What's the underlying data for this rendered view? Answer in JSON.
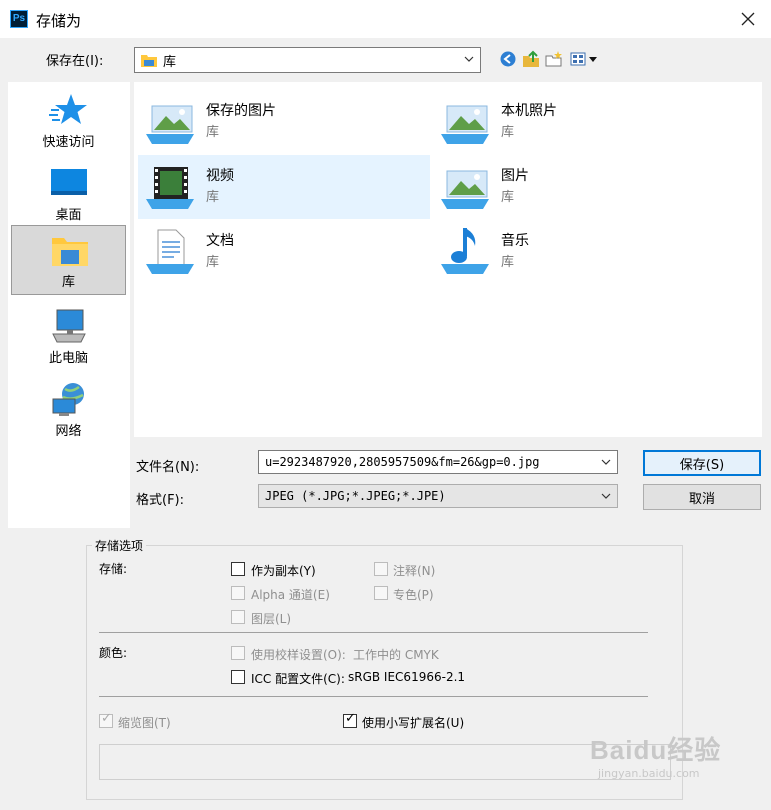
{
  "window": {
    "title": "存储为",
    "app_icon": "Ps"
  },
  "location": {
    "label": "保存在(I):",
    "value": "库"
  },
  "sidebar": {
    "items": [
      {
        "label": "快速访问",
        "icon": "star-icon"
      },
      {
        "label": "桌面",
        "icon": "desktop-icon"
      },
      {
        "label": "库",
        "icon": "library-folder-icon",
        "selected": true
      },
      {
        "label": "此电脑",
        "icon": "computer-icon"
      },
      {
        "label": "网络",
        "icon": "network-icon"
      }
    ]
  },
  "files": [
    {
      "name": "保存的图片",
      "type": "库"
    },
    {
      "name": "本机照片",
      "type": "库"
    },
    {
      "name": "视频",
      "type": "库",
      "highlighted": true
    },
    {
      "name": "图片",
      "type": "库"
    },
    {
      "name": "文档",
      "type": "库"
    },
    {
      "name": "音乐",
      "type": "库"
    }
  ],
  "filename": {
    "label": "文件名(N):",
    "value": "u=2923487920,2805957509&fm=26&gp=0.jpg"
  },
  "format": {
    "label": "格式(F):",
    "value": "JPEG (*.JPG;*.JPEG;*.JPE)"
  },
  "buttons": {
    "save": "保存(S)",
    "cancel": "取消"
  },
  "options": {
    "title": "存储选项",
    "storage_label": "存储:",
    "as_copy": "作为副本(Y)",
    "notes": "注释(N)",
    "alpha": "Alpha 通道(E)",
    "spot": "专色(P)",
    "layers": "图层(L)",
    "color_label": "颜色:",
    "proof": "使用校样设置(O):",
    "proof_value": "工作中的 CMYK",
    "icc": "ICC 配置文件(C):",
    "icc_value": "sRGB IEC61966-2.1",
    "thumbnail": "缩览图(T)",
    "lowercase": "使用小写扩展名(U)"
  },
  "watermark": {
    "brand": "Baidu经验",
    "url": "jingyan.baidu.com"
  },
  "colors": {
    "accent": "#0078d7",
    "highlight": "#e5f3ff",
    "folder": "#ffc83d"
  }
}
